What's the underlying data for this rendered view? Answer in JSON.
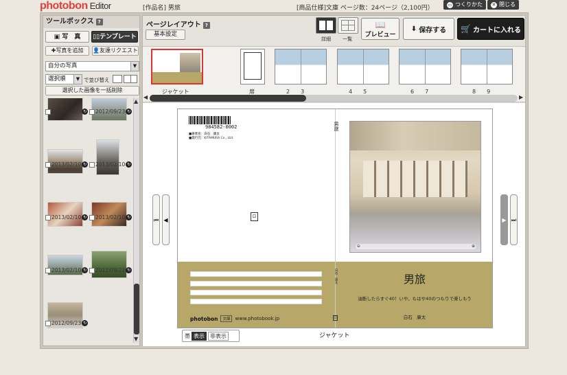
{
  "header": {
    "logo_text": "photobon",
    "logo_suffix": "Editor",
    "work_title": "[作品名] 男旅",
    "product_spec": "[商品仕様]文庫 ページ数：24ページ（2,100円）",
    "howto_label": "つくりかた",
    "close_label": "閉じる"
  },
  "toolbox": {
    "title": "ツールボックス",
    "help": "?",
    "tab_photo": "写　真",
    "tab_template": "テンプレート",
    "add_photo_label": "写真を追加",
    "friend_request_label": "友達リクエスト",
    "source_select": "自分の写真",
    "sort_select": "選択順",
    "sort_suffix": "で並び替え",
    "delete_all_label": "選択した画像を一括削除",
    "photos": [
      {
        "date": "2012/09/23"
      },
      {
        "date": "2012/09/23"
      },
      {
        "date": "2013/02/10"
      },
      {
        "date": "2013/02/10"
      },
      {
        "date": "2013/02/10"
      },
      {
        "date": "2013/02/10"
      },
      {
        "date": "2013/02/10"
      },
      {
        "date": "2012/09/22"
      },
      {
        "date": "2012/09/23"
      }
    ]
  },
  "layout": {
    "title": "ページレイアウト",
    "help": "?",
    "basic_settings": "基本設定",
    "view_detail_label": "詳細",
    "view_list_label": "一覧",
    "preview_label": "プレビュー",
    "save_label": "保存する",
    "cart_label": "カートに入れる",
    "thumbnails": [
      {
        "label": "ジャケット"
      },
      {
        "label": "扉"
      },
      {
        "label": "2　　3"
      },
      {
        "label": "4　　5"
      },
      {
        "label": "6　　7"
      },
      {
        "label": "8　　9"
      }
    ]
  },
  "cover": {
    "isbn": "984582-0002",
    "back_line1": "■著者名：白石　康太",
    "back_line2": "■発行元：KITAMURA Co., Ltd.",
    "spine_title": "男旅",
    "spine_author": "白石　康太",
    "title": "男旅",
    "subtitle": "油断したらすぐ40！いや、もはや40のつもりで楽しもう",
    "author": "白石　康太",
    "publisher_brand": "photobon",
    "publisher_tag": "文庫",
    "publisher_url": "www.photobook.jp"
  },
  "canvas": {
    "obi_label": "帯",
    "obi_show": "表示",
    "obi_hide": "非表示",
    "page_label": "ジャケット"
  }
}
